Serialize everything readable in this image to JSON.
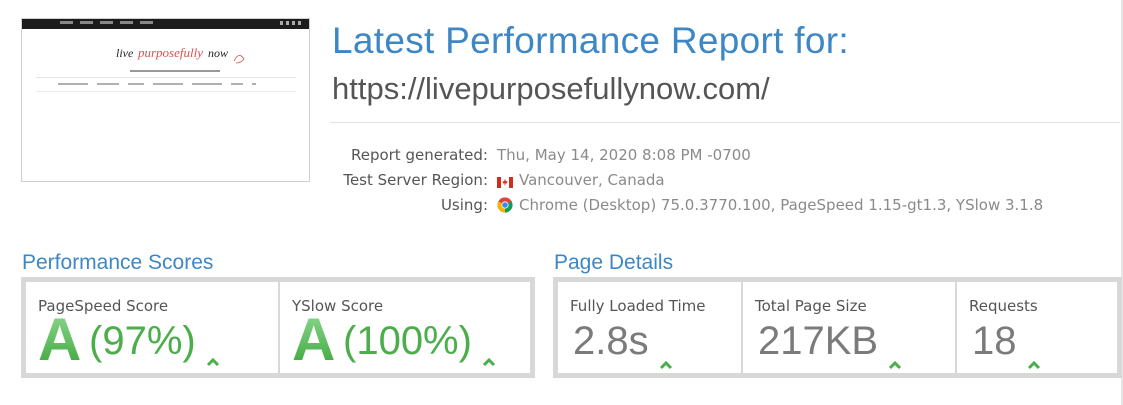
{
  "header": {
    "title": "Latest Performance Report for:",
    "url": "https://livepurposefullynow.com/"
  },
  "meta": {
    "rows": [
      {
        "label": "Report generated:",
        "value": "Thu, May 14, 2020 8:08 PM -0700"
      },
      {
        "label": "Test Server Region:",
        "value": "Vancouver, Canada",
        "icon": "canada-flag-icon"
      },
      {
        "label": "Using:",
        "value": "Chrome (Desktop) 75.0.3770.100, PageSpeed 1.15-gt1.3, YSlow 3.1.8",
        "icon": "chrome-icon"
      }
    ]
  },
  "thumbnail": {
    "logo_text": "live purposefully now"
  },
  "performance": {
    "title": "Performance Scores",
    "pagespeed": {
      "label": "PageSpeed Score",
      "grade": "A",
      "percent": "(97%)"
    },
    "yslow": {
      "label": "YSlow Score",
      "grade": "A",
      "percent": "(100%)"
    }
  },
  "details": {
    "title": "Page Details",
    "load_time": {
      "label": "Fully Loaded Time",
      "value": "2.8s"
    },
    "page_size": {
      "label": "Total Page Size",
      "value": "217KB"
    },
    "requests": {
      "label": "Requests",
      "value": "18"
    }
  },
  "colors": {
    "accent": "#3d87c6",
    "good": "#4bae4b",
    "muted": "#7b7b7b"
  }
}
